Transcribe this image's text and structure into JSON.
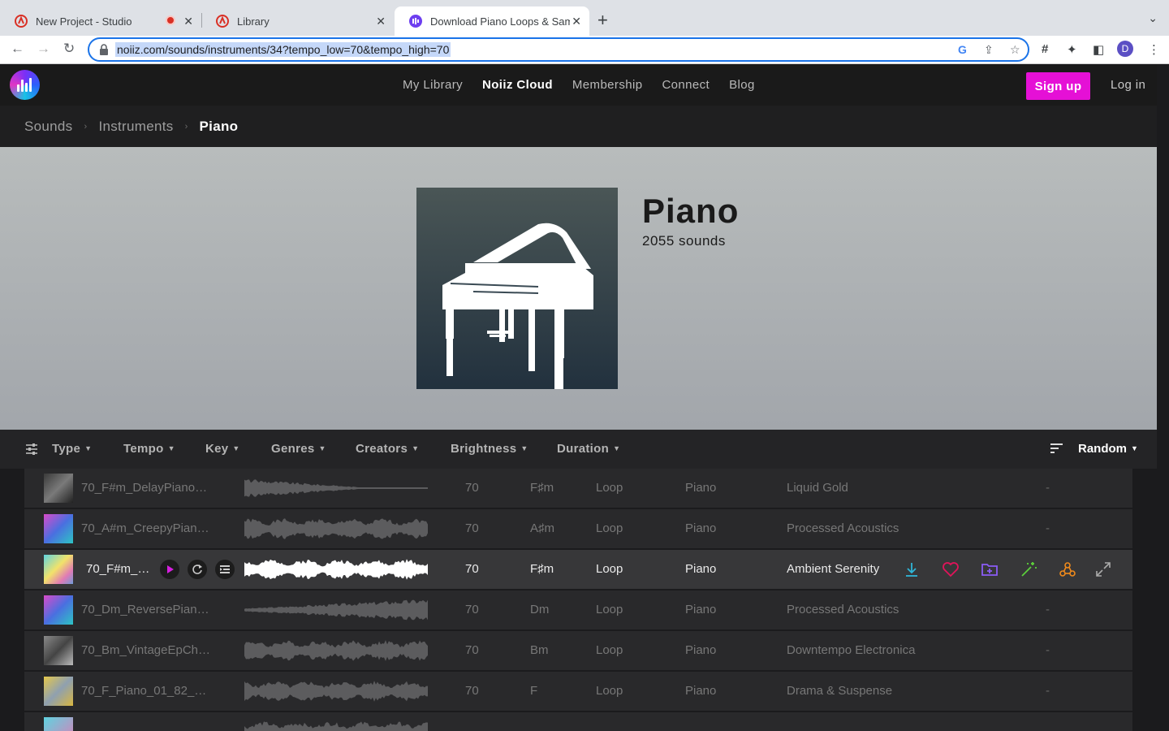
{
  "browser": {
    "tabs": [
      {
        "title": "New Project - Studio"
      },
      {
        "title": "Library"
      },
      {
        "title": "Download Piano Loops & Samp"
      }
    ],
    "url": "noiiz.com/sounds/instruments/34?tempo_low=70&tempo_high=70",
    "profile_initial": "D"
  },
  "site": {
    "nav": [
      "My Library",
      "Noiiz Cloud",
      "Membership",
      "Connect",
      "Blog"
    ],
    "signup_label": "Sign up",
    "login_label": "Log in"
  },
  "breadcrumb": [
    "Sounds",
    "Instruments",
    "Piano"
  ],
  "hero": {
    "title": "Piano",
    "count": "2055 sounds"
  },
  "filters": {
    "items": [
      "Type",
      "Tempo",
      "Key",
      "Genres",
      "Creators",
      "Brightness",
      "Duration"
    ],
    "sort_label": "Random"
  },
  "sounds": [
    {
      "name": "70_F#m_DelayPiano_...",
      "tempo": "70",
      "key": "F♯m",
      "type": "Loop",
      "instrument": "Piano",
      "genre": "Liquid Gold",
      "extra": "-"
    },
    {
      "name": "70_A#m_CreepyPiano...",
      "tempo": "70",
      "key": "A♯m",
      "type": "Loop",
      "instrument": "Piano",
      "genre": "Processed Acoustics",
      "extra": "-"
    },
    {
      "name": "70_F#m_A...",
      "tempo": "70",
      "key": "F♯m",
      "type": "Loop",
      "instrument": "Piano",
      "genre": "Ambient Serenity",
      "extra": ""
    },
    {
      "name": "70_Dm_ReversePiano...",
      "tempo": "70",
      "key": "Dm",
      "type": "Loop",
      "instrument": "Piano",
      "genre": "Processed Acoustics",
      "extra": "-"
    },
    {
      "name": "70_Bm_VintageEpChr...",
      "tempo": "70",
      "key": "Bm",
      "type": "Loop",
      "instrument": "Piano",
      "genre": "Downtempo Electronica",
      "extra": "-"
    },
    {
      "name": "70_F_Piano_01_82_SP....",
      "tempo": "70",
      "key": "F",
      "type": "Loop",
      "instrument": "Piano",
      "genre": "Drama & Suspense",
      "extra": "-"
    }
  ],
  "colors": {
    "accent": "#e510d6",
    "download": "#2fb6d8",
    "favorite": "#e0145a",
    "folder": "#8b5cf6",
    "magic": "#5ccf3b",
    "stems": "#f08a1c"
  }
}
